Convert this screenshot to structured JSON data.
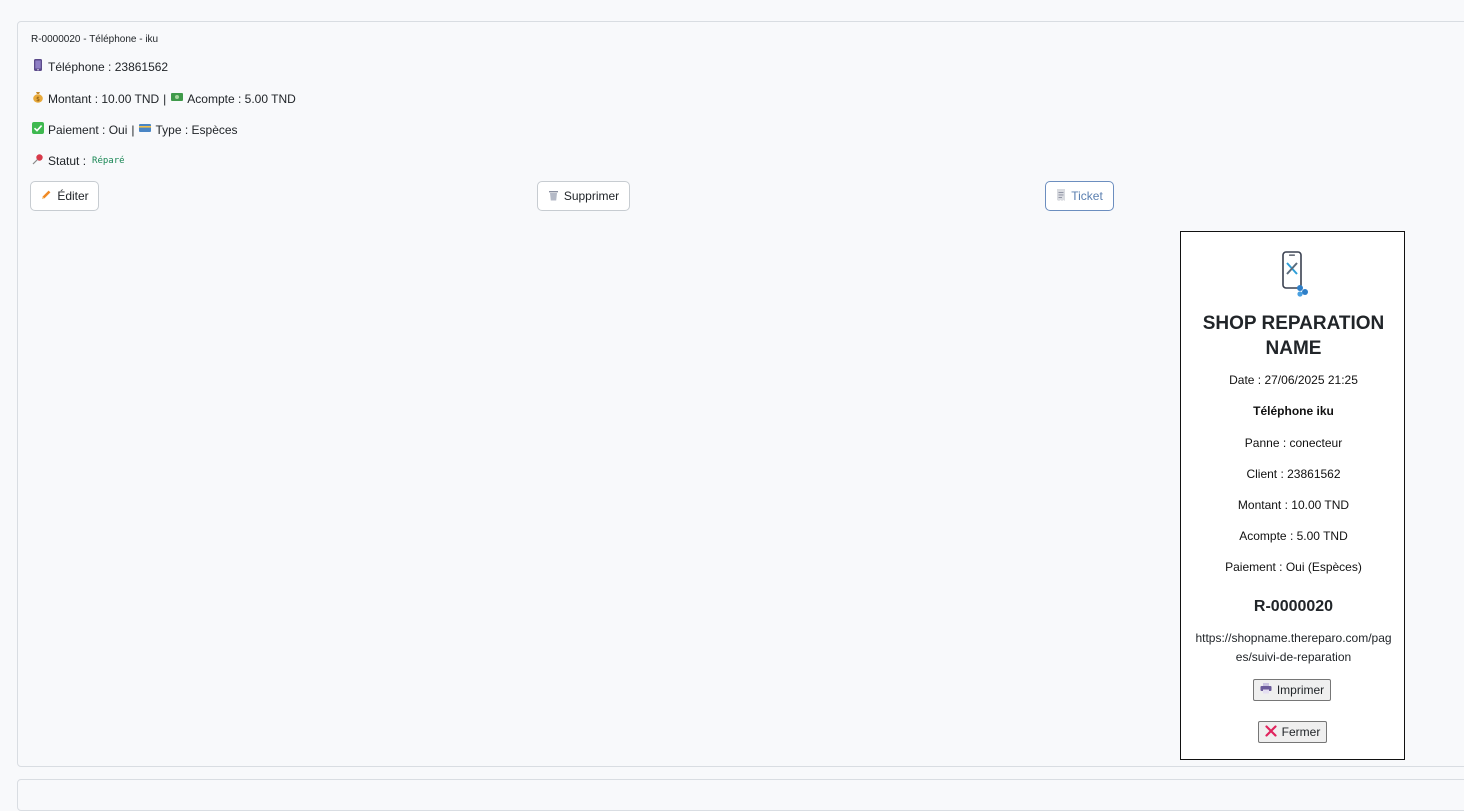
{
  "repair": {
    "title": "R-0000020 - Téléphone - iku",
    "phone_label": "Téléphone : 23861562",
    "amount_label": "Montant : 10.00 TND",
    "separator": "|",
    "deposit_label": "Acompte : 5.00 TND",
    "payment_label": "Paiement : Oui",
    "type_label": "Type : Espèces",
    "status_label": "Statut :",
    "status_value": "Réparé"
  },
  "icons": {
    "phone": "mobile-phone-icon",
    "money_bag": "money-bag-icon",
    "banknote": "banknote-icon",
    "check": "check-mark-icon",
    "card": "credit-card-icon",
    "pin": "pushpin-icon",
    "pencil": "pencil-icon",
    "trash": "wastebasket-icon",
    "receipt": "receipt-icon",
    "printer": "printer-icon",
    "cross": "cross-mark-icon"
  },
  "actions": {
    "edit": "Éditer",
    "delete": "Supprimer",
    "ticket": "Ticket"
  },
  "ticket": {
    "shop_name": "SHOP REPARATION NAME",
    "date": "Date : 27/06/2025 21:25",
    "device": "Téléphone iku",
    "issue": "Panne : conecteur",
    "client": "Client : 23861562",
    "amount": "Montant : 10.00 TND",
    "deposit": "Acompte : 5.00 TND",
    "payment": "Paiement : Oui (Espèces)",
    "reference": "R-0000020",
    "url": "https://shopname.thereparo.com/pages/suivi-de-reparation",
    "print_button": "Imprimer",
    "close_button": "Fermer"
  },
  "colors": {
    "status": "#198754",
    "ticket_button": "#5a7fb0",
    "close_icon": "#e0245e"
  }
}
